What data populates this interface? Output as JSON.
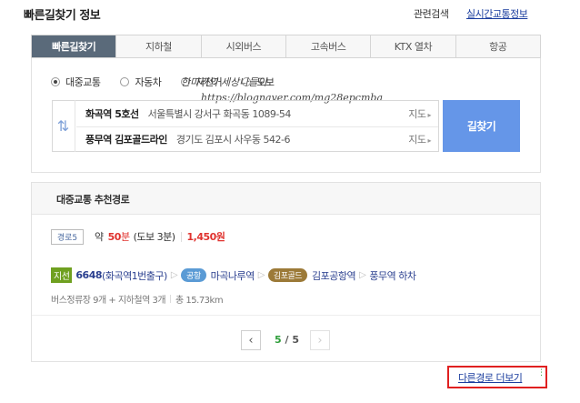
{
  "header": {
    "title": "빠른길찾기 정보",
    "related_search": "관련검색",
    "realtime_traffic": "실시간교통정보"
  },
  "tabs": [
    {
      "label": "빠른길찾기",
      "active": true
    },
    {
      "label": "지하철"
    },
    {
      "label": "시외버스"
    },
    {
      "label": "고속버스"
    },
    {
      "label": "KTX 열차"
    },
    {
      "label": "항공"
    }
  ],
  "modes": [
    {
      "label": "대중교통",
      "selected": true
    },
    {
      "label": "자동차"
    },
    {
      "label": "자전거"
    },
    {
      "label": "도보"
    }
  ],
  "watermark": {
    "line1": "한마리의 세상나들이",
    "line2": "https://blognaver.com/mg28epcmba"
  },
  "origin": {
    "name": "화곡역 5호선",
    "address": "서울특별시 강서구 화곡동 1089-54",
    "map_label": "지도"
  },
  "destination": {
    "name": "풍무역 김포골드라인",
    "address": "경기도 김포시 사우동 542-6",
    "map_label": "지도"
  },
  "search_button": "길찾기",
  "recommend": {
    "title": "대중교통 추천경로",
    "badge": "경로5",
    "about": "약",
    "time_value": "50",
    "time_unit": "분",
    "walk": "(도보 3분)",
    "fare": "1,450원"
  },
  "path": {
    "bus_tag": "지선",
    "bus_number": "6648",
    "bus_stop": "(화곡역1번출구)",
    "pill1": "공항",
    "station1": "마곡나루역",
    "pill2": "김포골드",
    "station2": "김포공항역",
    "dest": "풍무역 하차"
  },
  "stats": {
    "stops": "버스정류장 9개 + 지하철역 3개",
    "distance": "총 15.73km"
  },
  "pagination": {
    "current": "5",
    "separator": "/",
    "total": "5"
  },
  "more_link": "다른경로 더보기",
  "colors": {
    "accent_blue": "#6596e8",
    "time_red": "#e0322e",
    "bus_green": "#6fa020",
    "highlight_red": "#e02020"
  }
}
